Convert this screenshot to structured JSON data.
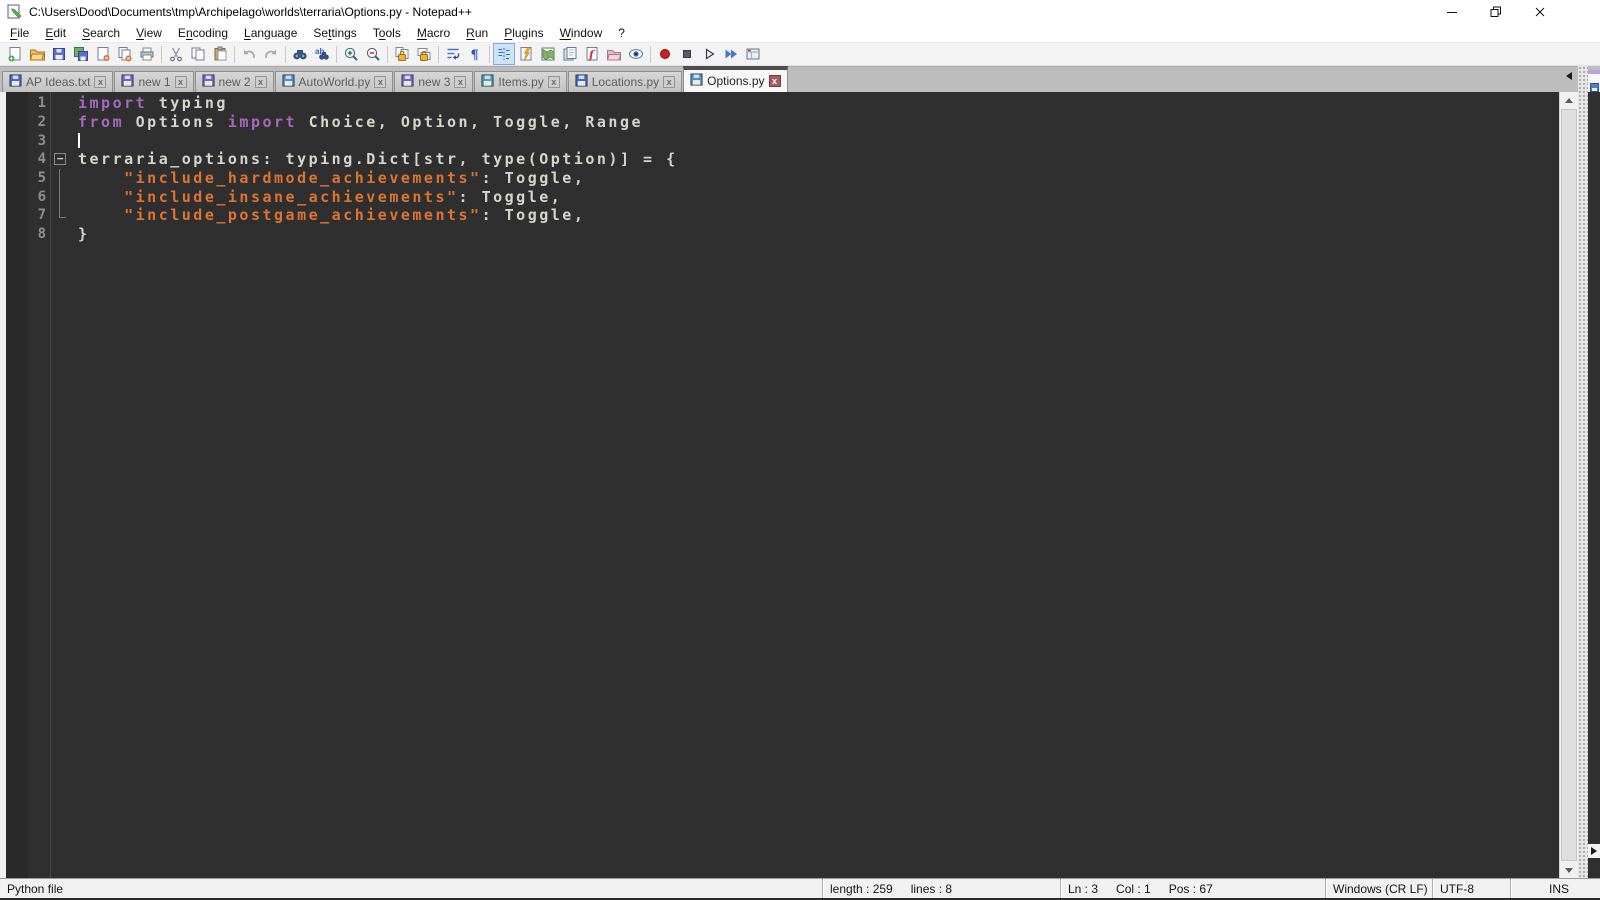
{
  "window": {
    "title": "C:\\Users\\Dood\\Documents\\tmp\\Archipelago\\worlds\\terraria\\Options.py - Notepad++",
    "app_icon": "notepadpp-icon",
    "controls": [
      {
        "name": "minimize-button",
        "icon": "minimize-icon"
      },
      {
        "name": "restore-button",
        "icon": "restore-icon"
      },
      {
        "name": "close-button",
        "icon": "close-icon"
      }
    ]
  },
  "menubar": {
    "items": [
      {
        "label": "File",
        "mnemonic": 0
      },
      {
        "label": "Edit",
        "mnemonic": 0
      },
      {
        "label": "Search",
        "mnemonic": 0
      },
      {
        "label": "View",
        "mnemonic": 0
      },
      {
        "label": "Encoding",
        "mnemonic": 1
      },
      {
        "label": "Language",
        "mnemonic": 0
      },
      {
        "label": "Settings",
        "mnemonic": 2
      },
      {
        "label": "Tools",
        "mnemonic": 1
      },
      {
        "label": "Macro",
        "mnemonic": 0
      },
      {
        "label": "Run",
        "mnemonic": 0
      },
      {
        "label": "Plugins",
        "mnemonic": 0
      },
      {
        "label": "Window",
        "mnemonic": 0
      },
      {
        "label": "?",
        "mnemonic": -1
      }
    ]
  },
  "toolbar": {
    "pressed": "show-indent-guide",
    "items": [
      "new-file",
      "open-file",
      "save",
      "save-all",
      "close",
      "close-all",
      "print",
      "|",
      "cut",
      "copy",
      "paste",
      "|",
      "undo",
      "redo",
      "|",
      "find",
      "replace",
      "|",
      "zoom-in",
      "zoom-out",
      "|",
      "sync-vertical-scrolling",
      "sync-horizontal-scrolling",
      "|",
      "word-wrap",
      "show-all-characters",
      "|",
      "show-indent-guide",
      "function-completion",
      "document-map",
      "document-switcher",
      "function-list",
      "folder-as-workspace",
      "file-monitoring",
      "|",
      "macro-record",
      "macro-stop",
      "macro-playback",
      "macro-run-multiple",
      "macro-save"
    ]
  },
  "tabbar": {
    "close_glyph": "x",
    "tabs": [
      {
        "label": "AP Ideas.txt",
        "icon_color": "#4a63c8",
        "active": false
      },
      {
        "label": "new 1",
        "icon_color": "#7a5ec2",
        "active": false
      },
      {
        "label": "new 2",
        "icon_color": "#7a5ec2",
        "active": false
      },
      {
        "label": "AutoWorld.py",
        "icon_color": "#4a8fc8",
        "active": false
      },
      {
        "label": "new 3",
        "icon_color": "#7a5ec2",
        "active": false
      },
      {
        "label": "Items.py",
        "icon_color": "#4a9fb0",
        "active": false
      },
      {
        "label": "Locations.py",
        "icon_color": "#4a63c8",
        "active": false
      },
      {
        "label": "Options.py",
        "icon_color": "#4a8fc8",
        "active": true
      }
    ]
  },
  "editor": {
    "fold_start_glyph": "−",
    "lines": [
      {
        "n": "1",
        "fold": "",
        "caret": false,
        "segs": [
          [
            "k",
            "import"
          ],
          [
            "d",
            " typing"
          ]
        ]
      },
      {
        "n": "2",
        "fold": "",
        "caret": false,
        "segs": [
          [
            "k",
            "from"
          ],
          [
            "d",
            " Options "
          ],
          [
            "k",
            "import"
          ],
          [
            "d",
            " Choice, Option, Toggle, Range"
          ]
        ]
      },
      {
        "n": "3",
        "fold": "",
        "caret": true,
        "segs": []
      },
      {
        "n": "4",
        "fold": "start",
        "caret": false,
        "segs": [
          [
            "d",
            "terraria_options: typing.Dict[str, type(Option)] = {"
          ]
        ]
      },
      {
        "n": "5",
        "fold": "mid",
        "caret": false,
        "segs": [
          [
            "d",
            "    "
          ],
          [
            "s",
            "\"include_hardmode_achievements\""
          ],
          [
            "d",
            ": Toggle,"
          ]
        ]
      },
      {
        "n": "6",
        "fold": "mid",
        "caret": false,
        "segs": [
          [
            "d",
            "    "
          ],
          [
            "s",
            "\"include_insane_achievements\""
          ],
          [
            "d",
            ": Toggle,"
          ]
        ]
      },
      {
        "n": "7",
        "fold": "end",
        "caret": false,
        "segs": [
          [
            "d",
            "    "
          ],
          [
            "s",
            "\"include_postgame_achievements\""
          ],
          [
            "d",
            ": Toggle,"
          ]
        ]
      },
      {
        "n": "8",
        "fold": "",
        "caret": false,
        "segs": [
          [
            "d",
            "}"
          ]
        ]
      }
    ]
  },
  "statusbar": {
    "doc_type": "Python file",
    "length_label": "length : 259",
    "lines_label": "lines : 8",
    "line_label": "Ln : 3",
    "col_label": "Col : 1",
    "pos_label": "Pos : 67",
    "eol": "Windows (CR LF)",
    "encoding": "UTF-8",
    "insert_mode": "INS"
  },
  "colors": {
    "editor_background": "#2f2f2f",
    "gutter_number": "#8f8f8f",
    "token_default": "#d6d6cc",
    "token_keyword": "#a767c0",
    "token_string": "#de7430",
    "active_tab_close": "#a85a62",
    "toolbar_pressed": "#cfe3f7"
  }
}
